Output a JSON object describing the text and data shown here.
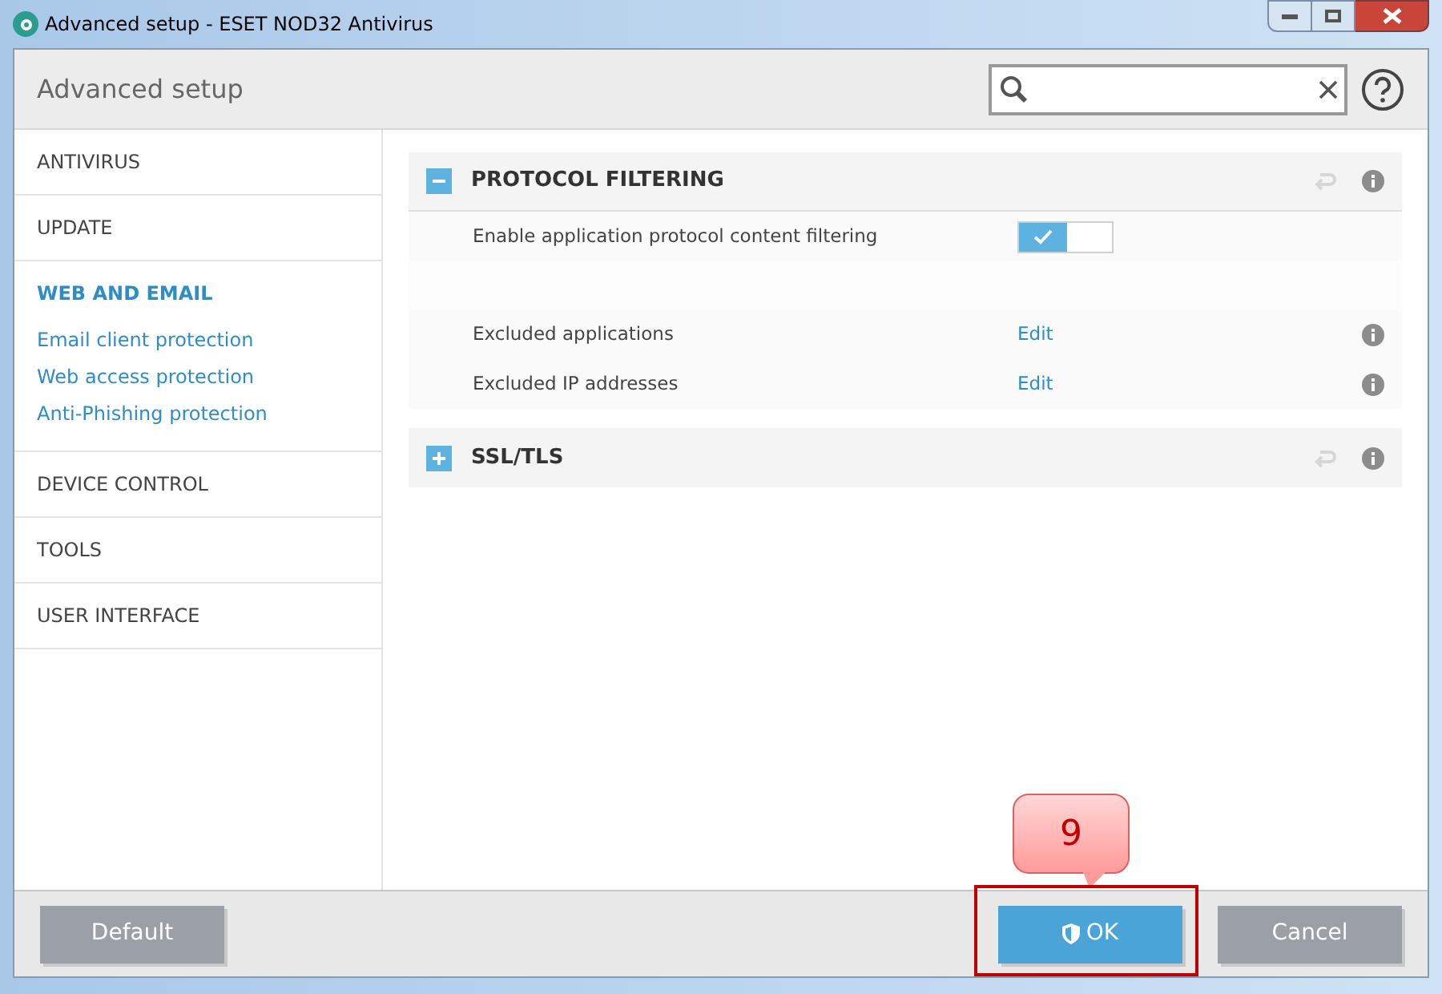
{
  "window": {
    "title": "Advanced setup - ESET NOD32 Antivirus"
  },
  "header": {
    "title": "Advanced setup"
  },
  "sidebar": {
    "items": [
      {
        "label": "ANTIVIRUS",
        "selected": false
      },
      {
        "label": "UPDATE",
        "selected": false
      },
      {
        "label": "WEB AND EMAIL",
        "selected": true,
        "children": [
          {
            "label": "Email client protection"
          },
          {
            "label": "Web access protection"
          },
          {
            "label": "Anti-Phishing protection"
          }
        ]
      },
      {
        "label": "DEVICE CONTROL",
        "selected": false
      },
      {
        "label": "TOOLS",
        "selected": false
      },
      {
        "label": "USER INTERFACE",
        "selected": false
      }
    ]
  },
  "sections": [
    {
      "title": "PROTOCOL FILTERING",
      "expanded": true,
      "rows": [
        {
          "kind": "toggle",
          "label": "Enable application protocol content filtering",
          "on": true
        },
        {
          "kind": "spacer"
        },
        {
          "kind": "link",
          "label": "Excluded applications",
          "link": "Edit"
        },
        {
          "kind": "link",
          "label": "Excluded IP addresses",
          "link": "Edit"
        }
      ]
    },
    {
      "title": "SSL/TLS",
      "expanded": false
    }
  ],
  "footer": {
    "buttons": [
      {
        "label": "Default",
        "kind": "default"
      },
      {
        "label": "OK",
        "kind": "ok"
      },
      {
        "label": "Cancel",
        "kind": "cancel"
      }
    ]
  },
  "callout": {
    "text": "9"
  }
}
